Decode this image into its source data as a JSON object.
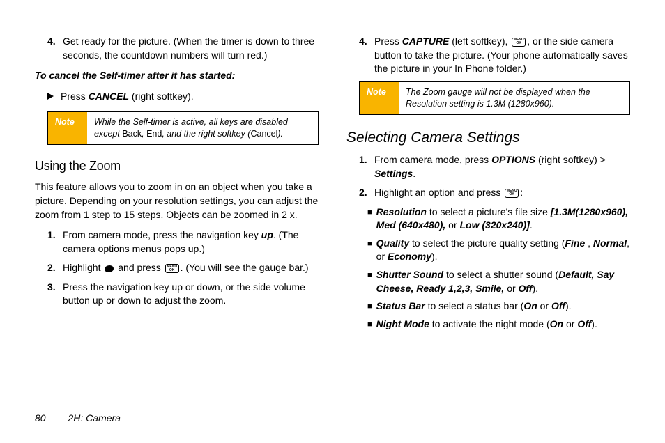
{
  "col1": {
    "step4": {
      "num": "4.",
      "text_a": "Get ready for the picture. (When the timer is down to three seconds, the countdown numbers will turn red.)"
    },
    "cancel_heading": "To cancel the Self-timer after it has started:",
    "cancel_bullet": {
      "press": "Press ",
      "cancel": "CANCEL",
      "rest": " (right softkey)."
    },
    "note1": {
      "label": "Note",
      "text_a": "While the Self-timer is active, all keys are disabled except  ",
      "back": "Back",
      "comma": ", ",
      "end": "End",
      "text_b": ", and the right softkey (",
      "cancel": "Cancel",
      "text_c": ")."
    },
    "zoom_heading": "Using the Zoom",
    "zoom_para": "This feature allows you to zoom in on an object when you take a picture. Depending on your resolution settings, you can adjust the zoom from 1 step to 15 steps. Objects can be zoomed in 2 x.",
    "z1": {
      "num": "1.",
      "a": "From camera mode, press the navigation key ",
      "up": "up",
      "b": ". (The camera options menus pops up.)"
    },
    "z2": {
      "num": "2.",
      "a": "Highlight  ",
      "b": " and press ",
      "c": ". (You will see the gauge bar.)"
    },
    "z3": {
      "num": "3.",
      "a": "Press the navigation key up or down, or  the side volume button up or down to adjust the zoom."
    }
  },
  "col2": {
    "s4": {
      "num": "4.",
      "a": "Press ",
      "capture": "CAPTURE",
      "b": " (left softkey), ",
      "c": ", or  the side camera button to take the picture. (Your phone automatically saves the picture in your In Phone folder.)"
    },
    "note2": {
      "label": "Note",
      "text": "The Zoom gauge will not be displayed when the Resolution setting is 1.3M (1280x960)."
    },
    "sel_heading": "Selecting Camera Settings",
    "s1": {
      "num": "1.",
      "a": "From camera mode, press ",
      "options": "OPTIONS",
      "b": " (right softkey) ",
      "gt": "> ",
      "settings": "Settings",
      "dot": "."
    },
    "s2": {
      "num": "2.",
      "a": "Highlight an option and press ",
      "b": ":"
    },
    "b1": {
      "res": "Resolution",
      "a": " to select a picture's file size ",
      "vals": "[1.3M(1280x960), Med (640x480),",
      "or": " or ",
      "low": "Low (320x240)]",
      "dot": "."
    },
    "b2": {
      "quality": "Quality",
      "a": " to select the picture quality setting (",
      "fine": "Fine",
      "c1": " , ",
      "normal": "Normal",
      "c2": ", or ",
      "economy": "Economy",
      "b": ")."
    },
    "b3": {
      "ss": "Shutter Sound",
      "a": " to select a shutter sound (",
      "vals": "Default, Say Cheese, Ready 1,2,3, Smile,",
      "or": " or ",
      "off": "Off",
      "b": ")."
    },
    "b4": {
      "sb": "Status Bar",
      "a": " to select a status bar (",
      "on": "On",
      "or": " or ",
      "off": "Off",
      "b": ")."
    },
    "b5": {
      "nm": "Night Mode",
      "a": " to activate the night mode (",
      "on": "On",
      "or": " or ",
      "off": "Off",
      "b": ")."
    }
  },
  "footer": {
    "page": "80",
    "section": "2H: Camera"
  },
  "icon_ok": {
    "menu": "MENU",
    "ok": "OK"
  }
}
